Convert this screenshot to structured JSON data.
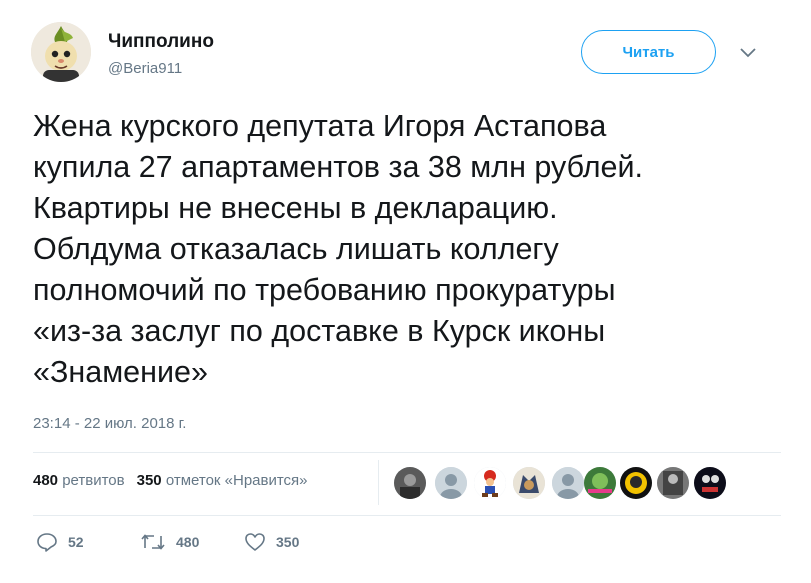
{
  "author": {
    "display_name": "Чипполино",
    "handle": "@Beria911"
  },
  "follow_button": {
    "label": "Читать"
  },
  "tweet": {
    "text_lines": [
      "Жена курского депутата Игоря Астапова",
      "купила 27 апартаментов за 38 млн рублей.",
      "Квартиры не внесены в декларацию.",
      "Облдума отказалась лишать коллегу",
      "полномочий по требованию прокуратуры",
      "«из-за заслуг по доставке в Курск иконы",
      "«Знамение»"
    ],
    "timestamp": "23:14 - 22 июл. 2018 г."
  },
  "stats": {
    "retweets_count": "480",
    "retweets_label": "ретвитов",
    "likes_count": "350",
    "likes_label": "отметок «Нравится»"
  },
  "actions": {
    "reply_count": "52",
    "retweet_count": "480",
    "like_count": "350"
  },
  "colors": {
    "accent": "#1da1f2",
    "secondary_text": "#657786",
    "primary_text": "#14171a",
    "divider": "#e6ecf0"
  }
}
